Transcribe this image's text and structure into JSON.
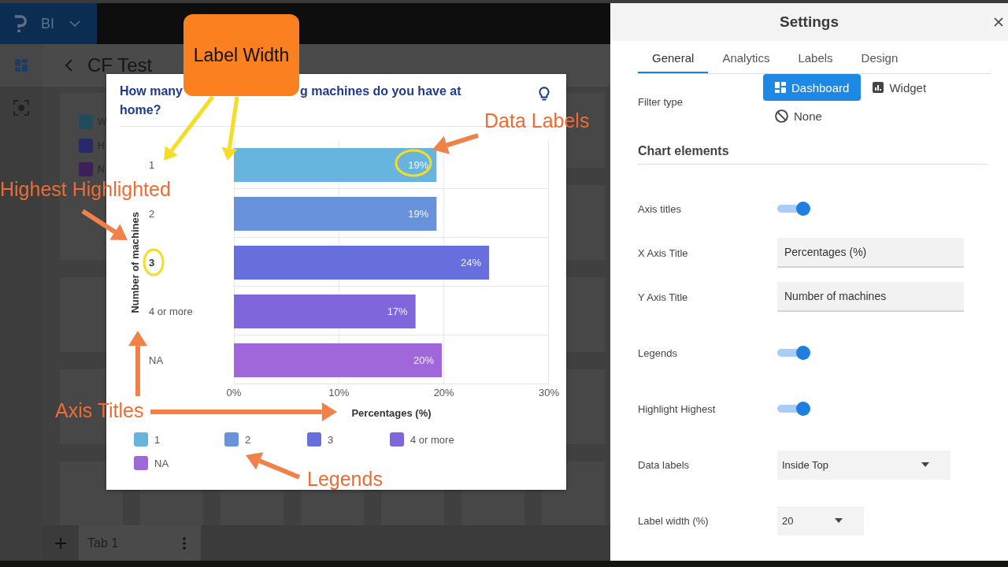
{
  "app": {
    "brand": "BI",
    "page_title": "CF Test",
    "background_widget": {
      "legend": [
        {
          "label": "W",
          "color": "#1f4c5d"
        },
        {
          "label": "H",
          "color": "#28296a"
        },
        {
          "label": "N",
          "color": "#3d2058"
        }
      ]
    },
    "tabs": [
      {
        "label": "Tab 1",
        "selected": true
      }
    ]
  },
  "chart_card": {
    "title_fragments": [
      "How many",
      "g machines do you have at",
      "home?"
    ],
    "highlight_highest": true,
    "chart_data": {
      "type": "bar",
      "orientation": "horizontal",
      "xlabel": "Percentages (%)",
      "ylabel": "Number of machines",
      "categories": [
        "1",
        "2",
        "3",
        "4 or more",
        "NA"
      ],
      "values": [
        19.3,
        19.3,
        24.3,
        17.3,
        19.8
      ],
      "xlim": [
        0,
        30
      ],
      "xticks": [
        {
          "value": 0,
          "label": "0%"
        },
        {
          "value": 10,
          "label": "10%"
        },
        {
          "value": 20,
          "label": "20%"
        },
        {
          "value": 30,
          "label": "30%"
        }
      ],
      "value_labels": [
        "19%",
        "19%",
        "24%",
        "17%",
        "20%"
      ]
    },
    "legend": [
      {
        "label": "1",
        "color": "#67b5de"
      },
      {
        "label": "2",
        "color": "#6892dc"
      },
      {
        "label": "3",
        "color": "#666fdb"
      },
      {
        "label": "4 or more",
        "color": "#7f67db"
      },
      {
        "label": "NA",
        "color": "#a067db"
      }
    ]
  },
  "annotations": [
    {
      "kind": "callout",
      "text": "Label Width"
    },
    {
      "kind": "note",
      "text": "Data Labels"
    },
    {
      "kind": "note",
      "text": "Highest Highlighted"
    },
    {
      "kind": "note",
      "text": "Axis Titles"
    },
    {
      "kind": "note",
      "text": "Legends"
    }
  ],
  "settings": {
    "title": "Settings",
    "tabs": [
      {
        "label": "General",
        "selected": true
      },
      {
        "label": "Analytics",
        "selected": false
      },
      {
        "label": "Labels",
        "selected": false
      },
      {
        "label": "Design",
        "selected": false
      }
    ],
    "filter_type": {
      "label": "Filter type",
      "options": [
        {
          "label": "Dashboard",
          "selected": true
        },
        {
          "label": "Widget",
          "selected": false
        },
        {
          "label": "None",
          "selected": false
        }
      ]
    },
    "section_title": "Chart elements",
    "rows": [
      {
        "kind": "toggle",
        "label": "Axis titles",
        "on": true
      },
      {
        "kind": "text",
        "label": "X Axis Title",
        "value": "Percentages (%)"
      },
      {
        "kind": "text",
        "label": "Y Axis Title",
        "value": "Number of machines"
      },
      {
        "kind": "toggle",
        "label": "Legends",
        "on": true
      },
      {
        "kind": "toggle",
        "label": "Highlight Highest",
        "on": true
      },
      {
        "kind": "select",
        "label": "Data labels",
        "value": "Inside Top"
      },
      {
        "kind": "select",
        "label": "Label width (%)",
        "value": "20"
      }
    ]
  }
}
